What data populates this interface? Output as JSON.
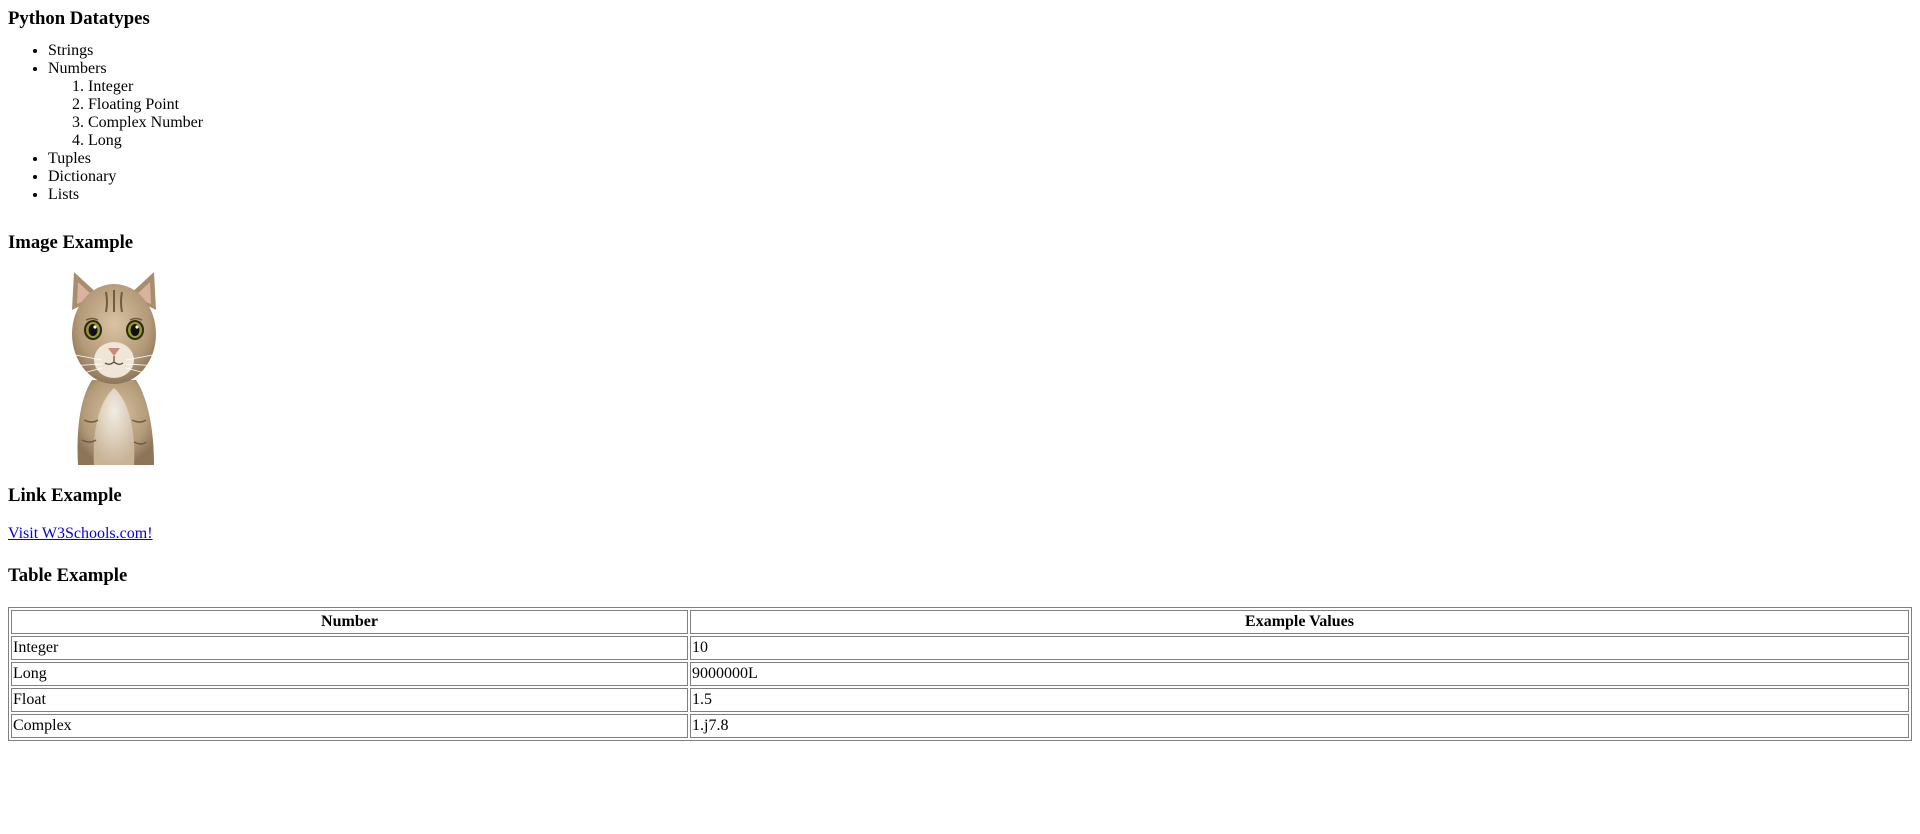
{
  "sections": {
    "datatypes_heading": "Python Datatypes",
    "image_heading": "Image Example",
    "link_heading": "Link Example",
    "table_heading": "Table Example"
  },
  "datatypes": {
    "strings": "Strings",
    "numbers": "Numbers",
    "number_types": [
      "Integer",
      "Floating Point",
      "Complex Number",
      "Long"
    ],
    "tuples": "Tuples",
    "dictionary": "Dictionary",
    "lists": "Lists"
  },
  "image": {
    "alt": "cat"
  },
  "link": {
    "text": "Visit W3Schools.com!",
    "color": "#0000ee"
  },
  "table": {
    "headers": [
      "Number",
      "Example Values"
    ],
    "rows": [
      [
        "Integer",
        "10"
      ],
      [
        "Long",
        "9000000L"
      ],
      [
        "Float",
        "1.5"
      ],
      [
        "Complex",
        "1.j7.8"
      ]
    ]
  }
}
